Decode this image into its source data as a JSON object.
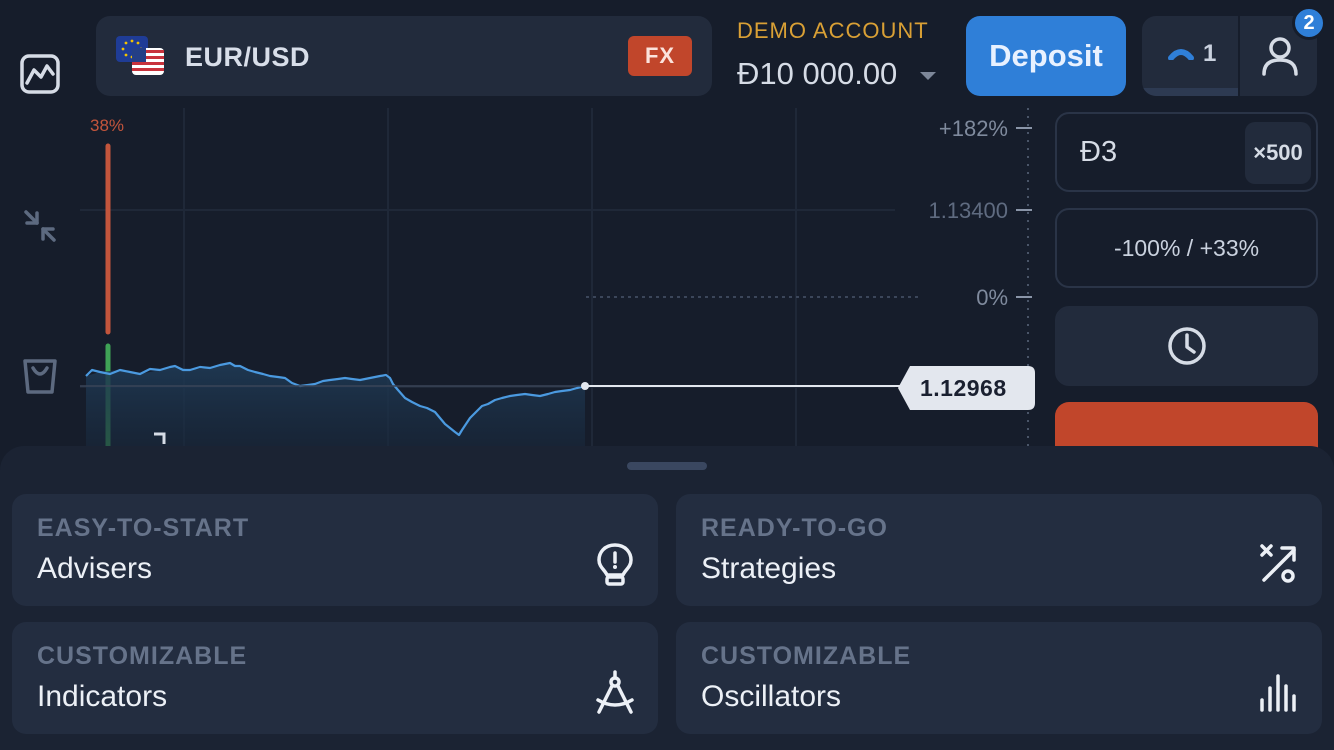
{
  "asset": {
    "name": "EUR/USD",
    "market_badge": "FX",
    "flag_icon": "eur-usd-flag-icon"
  },
  "account": {
    "type_label": "DEMO ACCOUNT",
    "balance": "Đ10 000.00",
    "deposit_label": "Deposit",
    "level_value": "1",
    "notification_count": "2"
  },
  "left_rail": [
    {
      "icon": "chart-area-icon"
    },
    {
      "icon": "collapse-arrows-icon"
    },
    {
      "icon": "shopping-bag-icon"
    }
  ],
  "chart": {
    "sentiment_top": "38%",
    "axis_labels": {
      "top_pct": "+182%",
      "price_level": "1.13400",
      "zero_pct": "0%"
    },
    "current_price": "1.12968",
    "colors": {
      "line": "#4b9ae0",
      "sentiment_sell": "#c3553c",
      "sentiment_buy": "#3fa356"
    }
  },
  "trade_panel": {
    "amount": "Đ3",
    "multiplier": "×500",
    "limits": "-100% / +33%",
    "timer_icon": "clock-icon"
  },
  "sheet": {
    "cards": [
      {
        "subtitle": "EASY-TO-START",
        "title": "Advisers",
        "icon": "lightbulb-icon"
      },
      {
        "subtitle": "READY-TO-GO",
        "title": "Strategies",
        "icon": "shuffle-strategy-icon"
      },
      {
        "subtitle": "CUSTOMIZABLE",
        "title": "Indicators",
        "icon": "compass-icon"
      },
      {
        "subtitle": "CUSTOMIZABLE",
        "title": "Oscillators",
        "icon": "bar-signal-icon"
      }
    ]
  }
}
